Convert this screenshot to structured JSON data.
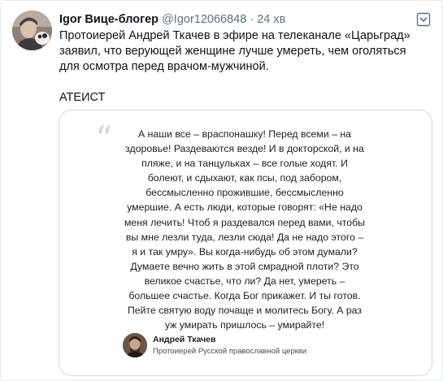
{
  "tweet": {
    "author_name": "Igor Вице-блогер",
    "handle": "@Igor12066848",
    "separator": "·",
    "time": "24 хв",
    "text": "Протоиерей Андрей Ткачев в эфире на телеканале «Царьград» заявил, что верующей женщине лучше умереть, чем оголяться для осмотра перед врачом-мужчиной.",
    "tag_line": "АТЕИСТ",
    "more_icon": "more-horizontal-icon"
  },
  "media": {
    "quote_icon": "quote-icon",
    "quote_text": "А наши все – враспонашку! Перед всеми – на здоровье! Раздеваются везде! И в докторской, и на пляже, и на танцульках – все голые ходят. И болеют, и сдыхают, как псы, под забором, бессмысленно прожившие, бессмысленно умершие. А есть люди, которые говорят: «Не надо меня лечить! Чтоб я раздевался перед вами, чтобы вы мне лезли туда, лезли сюда! Да не надо этого – я и так умру». Вы когда-нибудь об этом думали? Думаете вечно жить в этой смрадной плоти? Это великое счастье, что ли? Да нет, умереть – большее счастье. Когда Бог прикажет. И ты готов. Пейте святую воду почаще и молитесь Богу. А раз уж умирать пришлось – умирайте!",
    "author_name": "Андрей Ткачев",
    "author_title": "Протоиерей Русской православной церкви"
  }
}
